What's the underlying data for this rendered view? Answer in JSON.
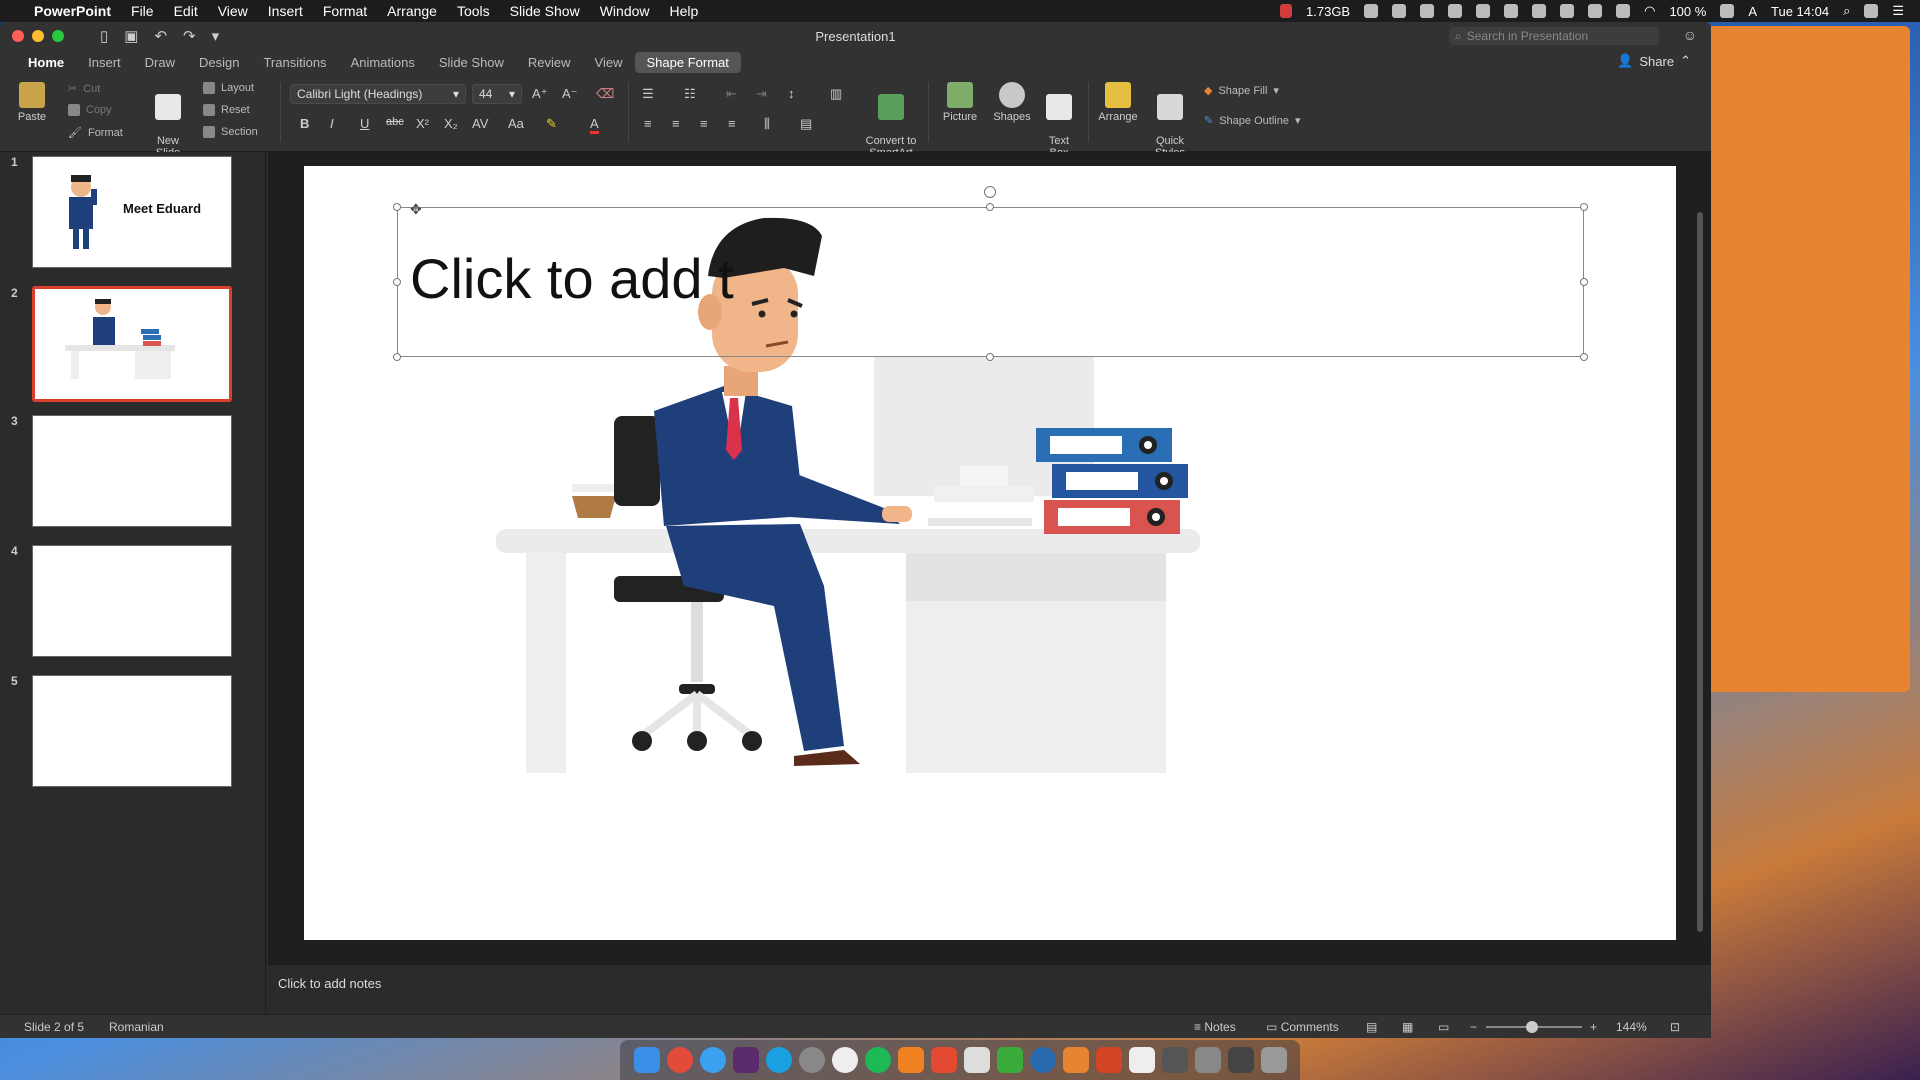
{
  "menubar": {
    "app_name": "PowerPoint",
    "items": [
      "File",
      "Edit",
      "View",
      "Insert",
      "Format",
      "Arrange",
      "Tools",
      "Slide Show",
      "Window",
      "Help"
    ],
    "memory": "1.73GB",
    "battery": "100 %",
    "clock": "Tue 14:04",
    "input_source": "A"
  },
  "window": {
    "title": "Presentation1",
    "search_placeholder": "Search in Presentation"
  },
  "tabs": [
    {
      "label": "Home"
    },
    {
      "label": "Insert"
    },
    {
      "label": "Draw"
    },
    {
      "label": "Design"
    },
    {
      "label": "Transitions"
    },
    {
      "label": "Animations"
    },
    {
      "label": "Slide Show"
    },
    {
      "label": "Review"
    },
    {
      "label": "View"
    },
    {
      "label": "Shape Format"
    }
  ],
  "share_label": "Share",
  "ribbon": {
    "paste": "Paste",
    "cut": "Cut",
    "copy": "Copy",
    "format": "Format",
    "new_slide": "New\nSlide",
    "layout": "Layout",
    "reset": "Reset",
    "section": "Section",
    "font_name": "Calibri Light (Headings)",
    "font_size": "44",
    "convert_smartart": "Convert to\nSmartArt",
    "picture": "Picture",
    "shapes": "Shapes",
    "text_box": "Text\nBox",
    "arrange": "Arrange",
    "quick_styles": "Quick\nStyles",
    "shape_fill": "Shape Fill",
    "shape_outline": "Shape Outline"
  },
  "slides": [
    {
      "num": "1",
      "title": "Meet Eduard"
    },
    {
      "num": "2",
      "title": ""
    },
    {
      "num": "3",
      "title": ""
    },
    {
      "num": "4",
      "title": ""
    },
    {
      "num": "5",
      "title": ""
    }
  ],
  "slide_canvas": {
    "title_placeholder": "Click to add t"
  },
  "notes_placeholder": "Click to add notes",
  "status": {
    "slide_counter": "Slide 2 of 5",
    "language": "Romanian",
    "notes": "Notes",
    "comments": "Comments",
    "zoom": "144%",
    "zoom_level": 0.48
  },
  "colors": {
    "selected_thumb_border": "#d8402b",
    "binder_blue": "#2a6fb5",
    "binder_red": "#d9534f",
    "suit_blue": "#1f3f7a"
  }
}
